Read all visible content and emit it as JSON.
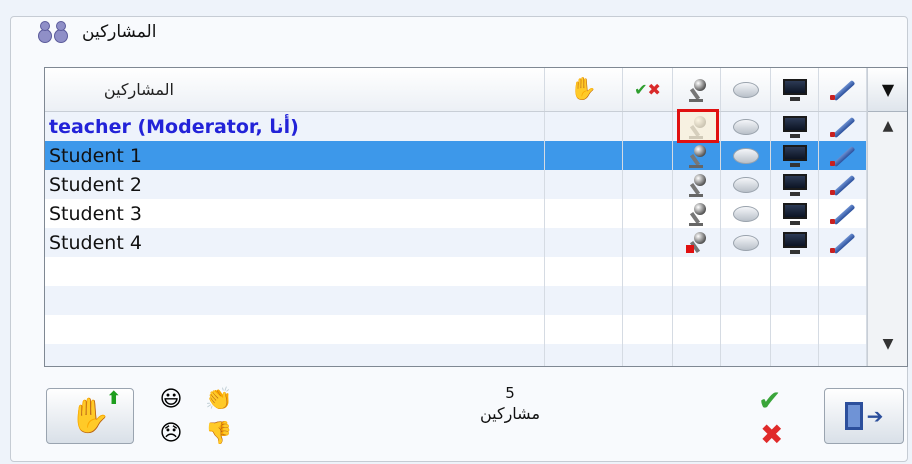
{
  "panel": {
    "title": "المشاركين",
    "icon": "users-group-icon"
  },
  "list": {
    "header_name": "المشاركين",
    "columns": [
      "raise-hand-icon",
      "check-cross-icon",
      "microphone-icon",
      "chat-bubble-icon",
      "monitor-icon",
      "pen-icon"
    ],
    "rows": [
      {
        "name": "teacher (Moderator, أنا)",
        "moderator": true,
        "mic": "dim",
        "highlight_mic": true
      },
      {
        "name": "Student 1",
        "selected": true,
        "mic": "normal"
      },
      {
        "name": "Student 2",
        "mic": "normal"
      },
      {
        "name": "Student 3",
        "mic": "normal"
      },
      {
        "name": "Student 4",
        "mic": "red"
      }
    ]
  },
  "footer": {
    "count": "5",
    "count_label": "مشاركين",
    "emoticons": [
      "smile-icon",
      "applause-icon",
      "sad-icon",
      "thumbs-down-icon"
    ]
  },
  "colors": {
    "selection": "#3d98ea",
    "moderator_text": "#2323d8",
    "highlight_border": "#e01010"
  }
}
